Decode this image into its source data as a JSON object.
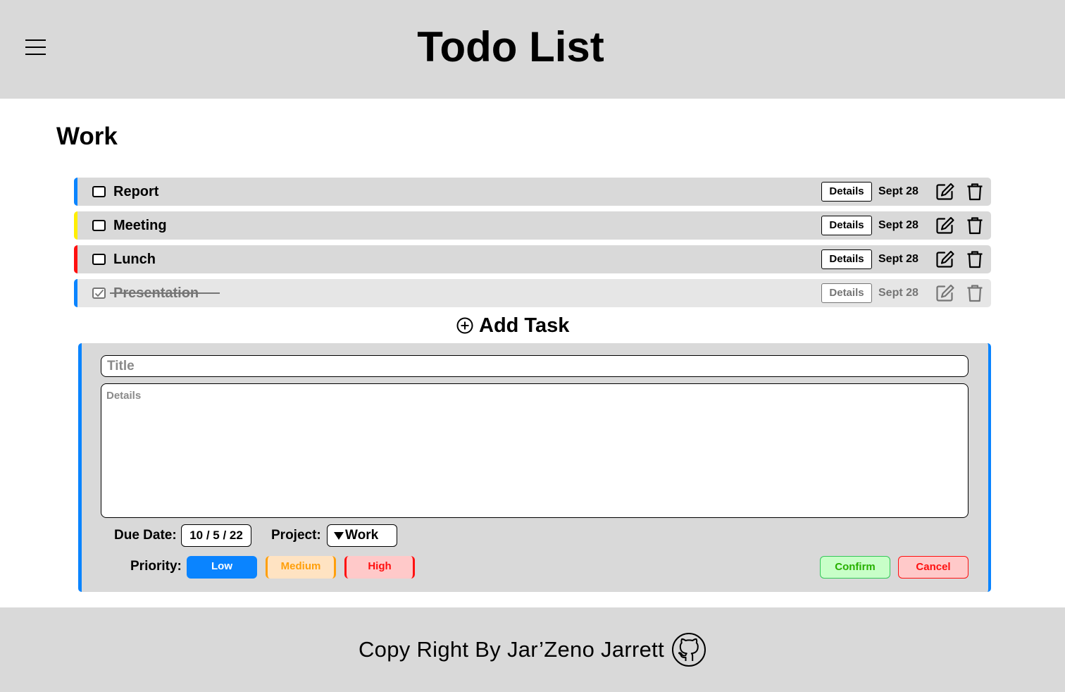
{
  "header": {
    "title": "Todo List",
    "menu_icon": "hamburger-menu-icon"
  },
  "project": {
    "title": "Work"
  },
  "tasks": [
    {
      "title": "Report",
      "details_label": "Details",
      "due": "Sept 28",
      "priority_color": "#0a84ff",
      "completed": false
    },
    {
      "title": "Meeting",
      "details_label": "Details",
      "due": "Sept 28",
      "priority_color": "#ffee00",
      "completed": false
    },
    {
      "title": "Lunch",
      "details_label": "Details",
      "due": "Sept 28",
      "priority_color": "#ff1010",
      "completed": false
    },
    {
      "title": "Presentation",
      "details_label": "Details",
      "due": "Sept 28",
      "priority_color": "#0a84ff",
      "completed": true
    }
  ],
  "add_task": {
    "label": "Add Task",
    "icon": "plus-circle-icon"
  },
  "form": {
    "title_placeholder": "Title",
    "details_placeholder": "Details",
    "due_label": "Due Date:",
    "due_value": "10 / 5 / 22",
    "project_label": "Project:",
    "project_value": "Work",
    "priority_label": "Priority:",
    "priorities": [
      "Low",
      "Medium",
      "High"
    ],
    "selected_priority": "Low",
    "confirm": "Confirm",
    "cancel": "Cancel"
  },
  "footer": {
    "text": "Copy Right By Jar’Zeno Jarrett",
    "icon": "github-icon"
  },
  "colors": {
    "accent": "#0a84ff",
    "medium": "#ff9f0a",
    "high": "#ff1010",
    "panel": "#d9d9d9",
    "confirm": "#27b000"
  }
}
